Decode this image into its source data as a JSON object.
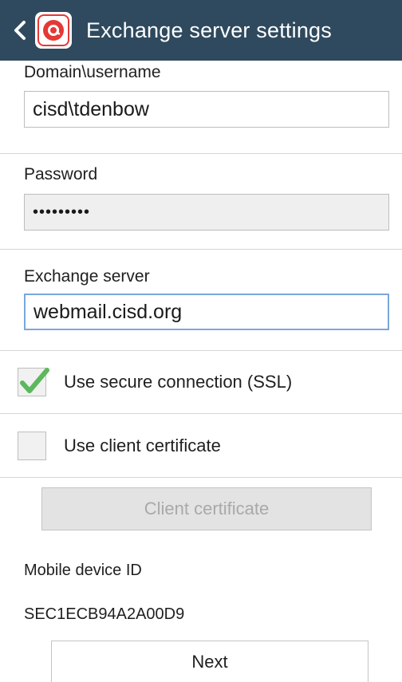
{
  "header": {
    "title": "Exchange server settings",
    "back_icon": "chevron-left-icon",
    "app_icon": "email-app-icon",
    "background_color": "#2f4a5e"
  },
  "domain_username": {
    "label": "Domain\\username",
    "value": "cisd\\tdenbow"
  },
  "password": {
    "label": "Password",
    "value": "•••••••••"
  },
  "exchange_server": {
    "label": "Exchange server",
    "value": "webmail.cisd.org"
  },
  "secure_connection": {
    "label": "Use secure connection (SSL)",
    "checked": true,
    "check_color": "#5cb85c"
  },
  "client_certificate_option": {
    "label": "Use client certificate",
    "checked": false
  },
  "client_certificate_button": {
    "label": "Client certificate"
  },
  "mobile_device": {
    "label": "Mobile device ID",
    "value": "SEC1ECB94A2A00D9"
  },
  "next_button": {
    "label": "Next"
  }
}
